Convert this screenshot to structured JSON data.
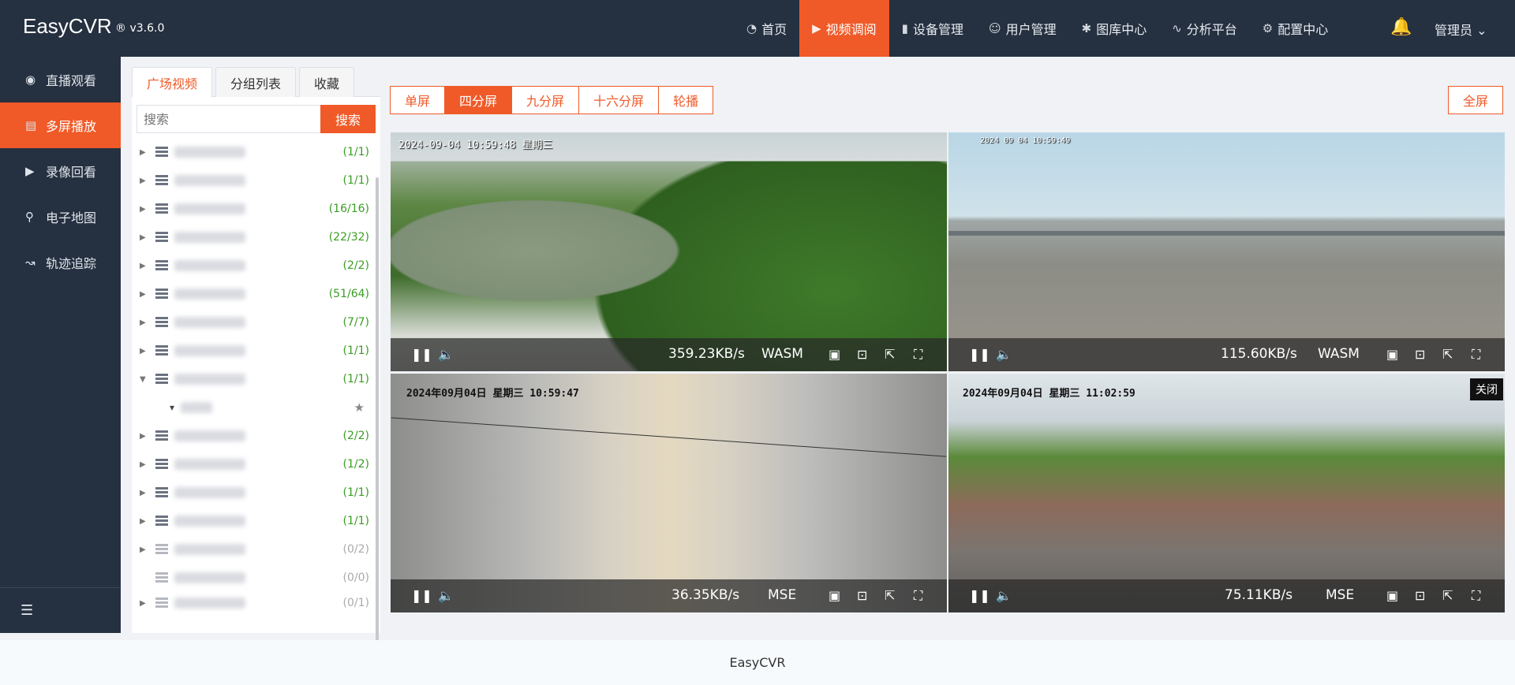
{
  "app": {
    "brand": "EasyCVR",
    "version": "® v3.6.0"
  },
  "nav": [
    {
      "label": "首页",
      "icon": "dashboard-icon",
      "active": false
    },
    {
      "label": "视频调阅",
      "icon": "play-circle-icon",
      "active": true
    },
    {
      "label": "设备管理",
      "icon": "device-icon",
      "active": false
    },
    {
      "label": "用户管理",
      "icon": "user-icon",
      "active": false
    },
    {
      "label": "图库中心",
      "icon": "gallery-icon",
      "active": false
    },
    {
      "label": "分析平台",
      "icon": "pulse-icon",
      "active": false
    },
    {
      "label": "配置中心",
      "icon": "gear-icon",
      "active": false
    }
  ],
  "user": {
    "name": "管理员"
  },
  "sidebar": {
    "items": [
      {
        "label": "直播观看",
        "icon": "play-circle-icon"
      },
      {
        "label": "多屏播放",
        "icon": "multi-screen-icon"
      },
      {
        "label": "录像回看",
        "icon": "video-camera-icon"
      },
      {
        "label": "电子地图",
        "icon": "map-pin-icon"
      },
      {
        "label": "轨迹追踪",
        "icon": "route-icon"
      }
    ]
  },
  "tree_panel": {
    "tabs": [
      "广场视频",
      "分组列表",
      "收藏"
    ],
    "search": {
      "placeholder": "搜索",
      "button": "搜索"
    },
    "nodes": [
      {
        "count": "(1/1)",
        "status": "green"
      },
      {
        "count": "(1/1)",
        "status": "green"
      },
      {
        "count": "(16/16)",
        "status": "green"
      },
      {
        "count": "(22/32)",
        "status": "green"
      },
      {
        "count": "(2/2)",
        "status": "green"
      },
      {
        "count": "(51/64)",
        "status": "green"
      },
      {
        "count": "(7/7)",
        "status": "green"
      },
      {
        "count": "(1/1)",
        "status": "green"
      },
      {
        "count": "(1/1)",
        "status": "green",
        "expanded": true
      },
      {
        "count": "(2/2)",
        "status": "green"
      },
      {
        "count": "(1/2)",
        "status": "green"
      },
      {
        "count": "(1/1)",
        "status": "green"
      },
      {
        "count": "(1/1)",
        "status": "green"
      },
      {
        "count": "(0/2)",
        "status": "gray"
      },
      {
        "count": "(0/0)",
        "status": "gray"
      },
      {
        "count": "(0/1)",
        "status": "gray"
      }
    ]
  },
  "modes": [
    {
      "label": "单屏",
      "active": false
    },
    {
      "label": "四分屏",
      "active": true
    },
    {
      "label": "九分屏",
      "active": false
    },
    {
      "label": "十六分屏",
      "active": false
    },
    {
      "label": "轮播",
      "active": false
    }
  ],
  "fullscreen_label": "全屏",
  "panes": [
    {
      "osd": "2024-09-04 10:59:48 星期三",
      "rate": "359.23KB/s",
      "decoder": "WASM"
    },
    {
      "osd": "2024 09 04 10:59:49",
      "rate": "115.60KB/s",
      "decoder": "WASM"
    },
    {
      "osd": "2024年09月04日 星期三 10:59:47",
      "rate": "36.35KB/s",
      "decoder": "MSE"
    },
    {
      "osd": "2024年09月04日 星期三 11:02:59",
      "rate": "75.11KB/s",
      "decoder": "MSE",
      "close": "关闭"
    }
  ],
  "footer": "EasyCVR"
}
